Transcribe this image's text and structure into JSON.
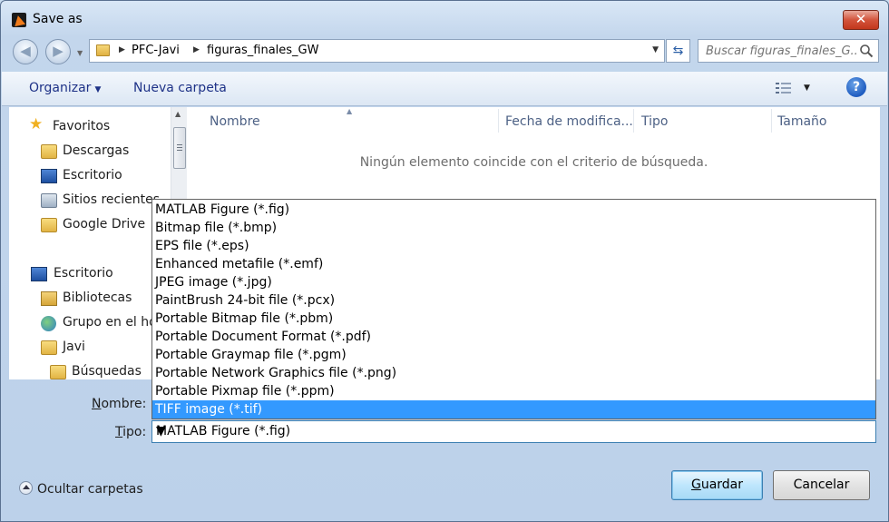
{
  "window": {
    "title": "Save as",
    "close_glyph": "✕"
  },
  "address": {
    "crumbs": [
      "PFC-Javi",
      "figuras_finales_GW"
    ],
    "search_placeholder": "Buscar figuras_finales_G..."
  },
  "toolbar": {
    "organize": "Organizar",
    "new_folder": "Nueva carpeta",
    "help": "?"
  },
  "nav": {
    "favorites": "Favoritos",
    "items": [
      {
        "label": "Descargas",
        "icon": "folder-icon"
      },
      {
        "label": "Escritorio",
        "icon": "desktop-icon"
      },
      {
        "label": "Sitios recientes",
        "icon": "recent-places-icon"
      },
      {
        "label": "Google Drive",
        "icon": "folder-icon"
      }
    ],
    "tree": [
      {
        "label": "Escritorio",
        "icon": "desktop-icon"
      },
      {
        "label": "Bibliotecas",
        "icon": "libraries-icon"
      },
      {
        "label": "Grupo en el hogar",
        "icon": "homegroup-icon"
      },
      {
        "label": "Javi",
        "icon": "user-folder-icon"
      },
      {
        "label": "Búsquedas",
        "icon": "searches-folder-icon"
      }
    ]
  },
  "columns": {
    "name": "Nombre",
    "date": "Fecha de modifica...",
    "type": "Tipo",
    "size": "Tamaño"
  },
  "empty_message": "Ningún elemento coincide con el criterio de búsqueda.",
  "file_types": [
    "MATLAB Figure (*.fig)",
    "Bitmap file  (*.bmp)",
    "EPS file (*.eps)",
    "Enhanced metafile  (*.emf)",
    "JPEG image (*.jpg)",
    "PaintBrush 24-bit file (*.pcx)",
    "Portable Bitmap file (*.pbm)",
    "Portable Document Format (*.pdf)",
    "Portable Graymap file (*.pgm)",
    "Portable Network Graphics file (*.png)",
    "Portable Pixmap file  (*.ppm)",
    "TIFF image (*.tif)"
  ],
  "highlighted_type": "TIFF image (*.tif)",
  "form": {
    "name_label_first": "N",
    "name_label_rest": "ombre:",
    "type_label_first": "T",
    "type_label_rest": "ipo:",
    "type_value": "MATLAB Figure (*.fig)"
  },
  "footer": {
    "hide_folders": "Ocultar carpetas",
    "save_first": "G",
    "save_rest": "uardar",
    "cancel": "Cancelar"
  }
}
